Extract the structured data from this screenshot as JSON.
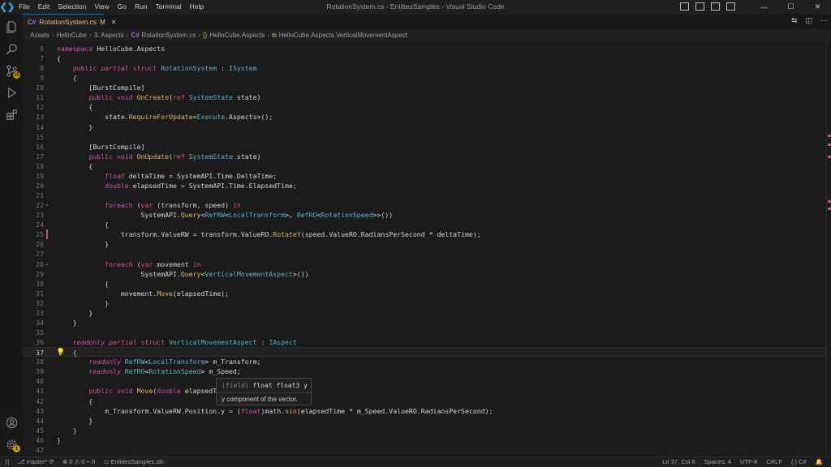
{
  "window": {
    "title": "RotationSystem.cs - EntitiesSamples - Visual Studio Code"
  },
  "menu": [
    "File",
    "Edit",
    "Selection",
    "View",
    "Go",
    "Run",
    "Terminal",
    "Help"
  ],
  "activity": {
    "source_control_badge": "15",
    "settings_badge": "1"
  },
  "tab": {
    "label": "RotationSystem.cs",
    "modified": "M",
    "icon": "C#"
  },
  "breadcrumb": [
    "Assets",
    "HelloCube",
    "3. Aspects",
    "RotationSystem.cs",
    "HelloCube.Aspects",
    "HelloCube.Aspects.VerticalMovementAspect"
  ],
  "breadcrumb_icons": {
    "file": "C#",
    "namespace": "{}",
    "struct": "struct-icon"
  },
  "code_lines": [
    {
      "n": "6",
      "text": "namespace HelloCube.Aspects"
    },
    {
      "n": "7",
      "text": "{"
    },
    {
      "n": "8",
      "text": "    public partial struct RotationSystem : ISystem"
    },
    {
      "n": "9",
      "text": "    {"
    },
    {
      "n": "10",
      "text": "        [BurstCompile]"
    },
    {
      "n": "11",
      "text": "        public void OnCreate(ref SystemState state)"
    },
    {
      "n": "12",
      "text": "        {"
    },
    {
      "n": "13",
      "text": "            state.RequireForUpdate<Execute.Aspects>();"
    },
    {
      "n": "14",
      "text": "        }"
    },
    {
      "n": "15",
      "text": ""
    },
    {
      "n": "16",
      "text": "        [BurstCompile]"
    },
    {
      "n": "17",
      "text": "        public void OnUpdate(ref SystemState state)"
    },
    {
      "n": "18",
      "text": "        {"
    },
    {
      "n": "19",
      "text": "            float deltaTime = SystemAPI.Time.DeltaTime;"
    },
    {
      "n": "20",
      "text": "            double elapsedTime = SystemAPI.Time.ElapsedTime;"
    },
    {
      "n": "21",
      "text": ""
    },
    {
      "n": "22",
      "text": "            foreach (var (transform, speed) in"
    },
    {
      "n": "23",
      "text": "                     SystemAPI.Query<RefRW<LocalTransform>, RefRO<RotationSpeed>>())"
    },
    {
      "n": "24",
      "text": "            {"
    },
    {
      "n": "25",
      "text": "                transform.ValueRW = transform.ValueRO.RotateY(speed.ValueRO.RadiansPerSecond * deltaTime);"
    },
    {
      "n": "26",
      "text": "            }"
    },
    {
      "n": "27",
      "text": ""
    },
    {
      "n": "28",
      "text": "            foreach (var movement in"
    },
    {
      "n": "29",
      "text": "                     SystemAPI.Query<VerticalMovementAspect>())"
    },
    {
      "n": "30",
      "text": "            {"
    },
    {
      "n": "31",
      "text": "                movement.Move(elapsedTime);"
    },
    {
      "n": "32",
      "text": "            }"
    },
    {
      "n": "33",
      "text": "        }"
    },
    {
      "n": "34",
      "text": "    }"
    },
    {
      "n": "35",
      "text": ""
    },
    {
      "n": "36",
      "text": "    readonly partial struct VerticalMovementAspect : IAspect"
    },
    {
      "n": "37",
      "text": "    {"
    },
    {
      "n": "38",
      "text": "        readonly RefRW<LocalTransform> m_Transform;"
    },
    {
      "n": "39",
      "text": "        readonly RefRO<RotationSpeed> m_Speed;"
    },
    {
      "n": "40",
      "text": ""
    },
    {
      "n": "41",
      "text": "        public void Move(double elapsedTi"
    },
    {
      "n": "42",
      "text": "        {"
    },
    {
      "n": "43",
      "text": "            m_Transform.ValueRW.Position.y = (float)math.sin(elapsedTime * m_Speed.ValueRO.RadiansPerSecond);"
    },
    {
      "n": "44",
      "text": "        }"
    },
    {
      "n": "45",
      "text": "    }"
    },
    {
      "n": "46",
      "text": "}"
    },
    {
      "n": "47",
      "text": ""
    }
  ],
  "current_line": "37",
  "hover": {
    "signature_kind": "(field)",
    "signature": "float float3 y",
    "description": "y component of the vector."
  },
  "status": {
    "branch": "master*",
    "errors": "0",
    "warnings": "0",
    "ports": "0",
    "solution": "EntitiesSamples.sln",
    "position": "Ln 37, Col 6",
    "spaces": "Spaces: 4",
    "encoding": "UTF-8",
    "eol": "CRLF",
    "language": "C#"
  },
  "colors": {
    "keyword": "#d3519e",
    "type": "#56b6c2",
    "function": "#dcb862",
    "accent": "#0078d4",
    "modified_tab": "#e3c07a"
  }
}
